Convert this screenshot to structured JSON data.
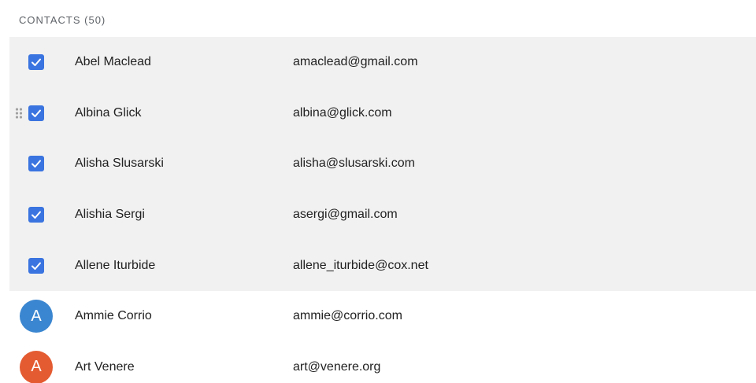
{
  "header": {
    "title": "CONTACTS (50)"
  },
  "contacts": [
    {
      "name": "Abel Maclead",
      "email": "amaclead@gmail.com",
      "selected": true,
      "avatar_letter": "",
      "avatar_color": ""
    },
    {
      "name": "Albina Glick",
      "email": "albina@glick.com",
      "selected": true,
      "avatar_letter": "",
      "avatar_color": "",
      "show_drag": true
    },
    {
      "name": "Alisha Slusarski",
      "email": "alisha@slusarski.com",
      "selected": true,
      "avatar_letter": "",
      "avatar_color": ""
    },
    {
      "name": "Alishia Sergi",
      "email": "asergi@gmail.com",
      "selected": true,
      "avatar_letter": "",
      "avatar_color": ""
    },
    {
      "name": "Allene Iturbide",
      "email": "allene_iturbide@cox.net",
      "selected": true,
      "avatar_letter": "",
      "avatar_color": ""
    },
    {
      "name": "Ammie Corrio",
      "email": "ammie@corrio.com",
      "selected": false,
      "avatar_letter": "A",
      "avatar_color": "#3b86d0"
    },
    {
      "name": "Art Venere",
      "email": "art@venere.org",
      "selected": false,
      "avatar_letter": "A",
      "avatar_color": "#e45b31"
    }
  ],
  "colors": {
    "checkbox": "#3a74e0",
    "selected_row": "#f1f1f1"
  },
  "icons": {
    "checkbox": "check-icon",
    "drag": "drag-handle-icon"
  }
}
